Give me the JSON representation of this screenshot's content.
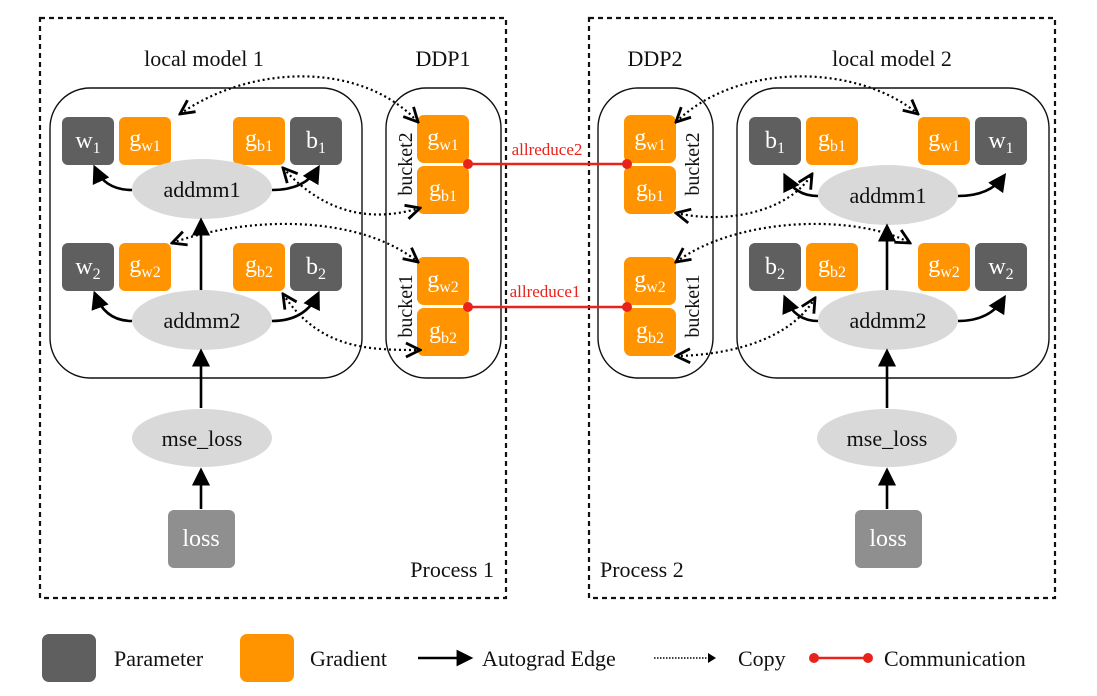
{
  "colors": {
    "parameter": "#5f5f5f",
    "gradient": "#ff9400",
    "loss": "#8f8f8f",
    "op": "#d9d9d9",
    "communication": "#e8231b"
  },
  "processes": [
    {
      "label": "Process 1",
      "local_model_title": "local model 1",
      "ddp_title": "DDP1",
      "ops": [
        "addmm1",
        "addmm2",
        "mse_loss"
      ],
      "loss_label": "loss",
      "params": [
        {
          "base": "w",
          "sub": "1"
        },
        {
          "base": "g",
          "sub": "w1"
        },
        {
          "base": "g",
          "sub": "b1"
        },
        {
          "base": "b",
          "sub": "1"
        },
        {
          "base": "w",
          "sub": "2"
        },
        {
          "base": "g",
          "sub": "w2"
        },
        {
          "base": "g",
          "sub": "b2"
        },
        {
          "base": "b",
          "sub": "2"
        }
      ],
      "buckets": [
        {
          "label": "bucket2",
          "grads": [
            {
              "base": "g",
              "sub": "w1"
            },
            {
              "base": "g",
              "sub": "b1"
            }
          ]
        },
        {
          "label": "bucket1",
          "grads": [
            {
              "base": "g",
              "sub": "w2"
            },
            {
              "base": "g",
              "sub": "b2"
            }
          ]
        }
      ]
    },
    {
      "label": "Process 2",
      "local_model_title": "local model 2",
      "ddp_title": "DDP2",
      "ops": [
        "addmm1",
        "addmm2",
        "mse_loss"
      ],
      "loss_label": "loss",
      "params": [
        {
          "base": "b",
          "sub": "1"
        },
        {
          "base": "g",
          "sub": "b1"
        },
        {
          "base": "g",
          "sub": "w1"
        },
        {
          "base": "w",
          "sub": "1"
        },
        {
          "base": "b",
          "sub": "2"
        },
        {
          "base": "g",
          "sub": "b2"
        },
        {
          "base": "g",
          "sub": "w2"
        },
        {
          "base": "w",
          "sub": "2"
        }
      ],
      "buckets": [
        {
          "label": "bucket2",
          "grads": [
            {
              "base": "g",
              "sub": "w1"
            },
            {
              "base": "g",
              "sub": "b1"
            }
          ]
        },
        {
          "label": "bucket1",
          "grads": [
            {
              "base": "g",
              "sub": "w2"
            },
            {
              "base": "g",
              "sub": "b2"
            }
          ]
        }
      ]
    }
  ],
  "communications": [
    "allreduce2",
    "allreduce1"
  ],
  "legend": {
    "parameter": "Parameter",
    "gradient": "Gradient",
    "autograd_edge": "Autograd Edge",
    "copy": "Copy",
    "communication": "Communication"
  }
}
